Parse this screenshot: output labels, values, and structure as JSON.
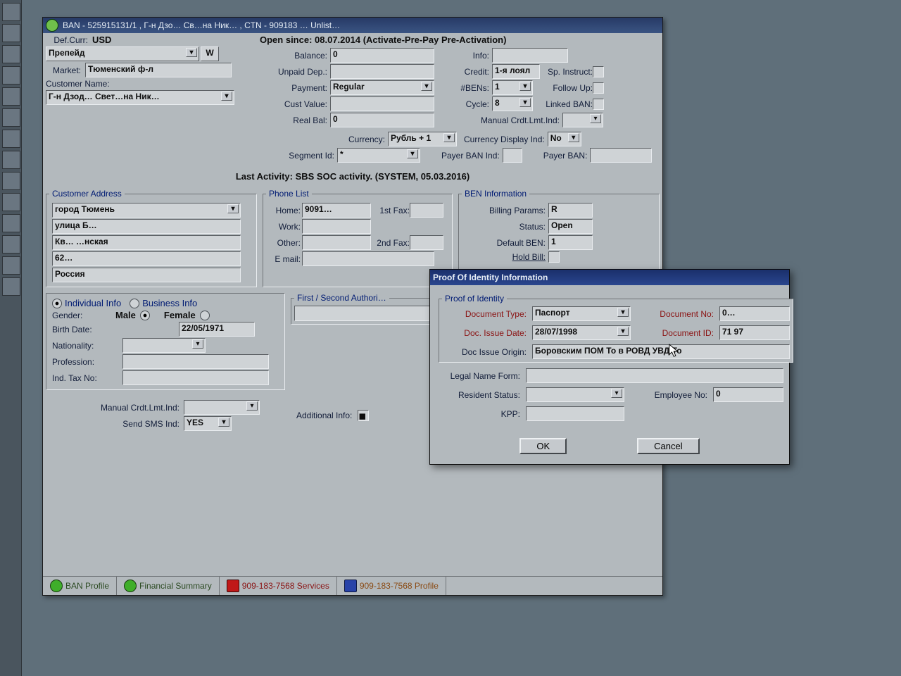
{
  "window": {
    "title": "BAN - 525915131/1 , Г-н Дзо… Св…на Ник… , CTN - 909183 …  Unlist…",
    "def_curr_label": "Def.Curr:",
    "def_curr": "USD",
    "open_since": "Open since: 08.07.2014 (Activate-Pre-Pay Pre-Activation)",
    "plan": "Препейд",
    "W": "W",
    "market_label": "Market:",
    "market": "Тюменский ф-л",
    "custname_label": "Customer Name:",
    "custname": "Г-н Дзод…  Свет…на Ник…"
  },
  "mid": {
    "balance_l": "Balance:",
    "balance": "0",
    "unpaid_l": "Unpaid Dep.:",
    "payment_l": "Payment:",
    "payment": "Regular",
    "custval_l": "Cust Value:",
    "realbal_l": "Real Bal:",
    "realbal": "0",
    "info_l": "Info:",
    "credit_l": "Credit:",
    "credit": "1-я лоял",
    "spinstr_l": "Sp. Instruct:",
    "bens_l": "#BENs:",
    "bens": "1",
    "followup_l": "Follow Up:",
    "cycle_l": "Cycle:",
    "cycle": "8",
    "linkedban_l": "Linked BAN:",
    "manualcrdt_l": "Manual Crdt.Lmt.Ind:",
    "currency_l": "Currency:",
    "currency": "Рубль + 1",
    "currdisp_l": "Currency Display Ind:",
    "currdisp": "No",
    "segment_l": "Segment Id:",
    "segment": "*",
    "payerbanind_l": "Payer BAN Ind:",
    "payerban_l": "Payer BAN:"
  },
  "activity": "Last Activity: SBS SOC activity. (SYSTEM, 05.03.2016)",
  "addr": {
    "title": "Customer Address",
    "line1": "город Тюмень",
    "line2": "улица Б…",
    "line3": "  Кв…                        …нская",
    "line4": "62…",
    "line5": "Россия"
  },
  "phone": {
    "title": "Phone List",
    "home_l": "Home:",
    "home": "9091…",
    "work_l": "Work:",
    "other_l": "Other:",
    "email_l": "E mail:",
    "fax1_l": "1st Fax:",
    "fax2_l": "2nd Fax:"
  },
  "ben": {
    "title": "BEN Information",
    "billing_l": "Billing Params:",
    "billing": "R",
    "status_l": "Status:",
    "status": "Open",
    "defben_l": "Default BEN:",
    "defben": "1",
    "hold_l": "Hold Bill:",
    "auth_l": "First / Second  Authori…"
  },
  "indiv": {
    "opt_ind": "Individual Info",
    "opt_bus": "Business Info",
    "gender_l": "Gender:",
    "male": "Male",
    "female": "Female",
    "birth_l": "Birth Date:",
    "birth": "22/05/1971",
    "nat_l": "Nationality:",
    "prof_l": "Profession:",
    "tax_l": "Ind. Tax No:"
  },
  "bottom": {
    "manualcrdt_l": "Manual Crdt.Lmt.Ind:",
    "sms_l": "Send SMS Ind:",
    "sms": "YES",
    "addinfo_l": "Additional Info:"
  },
  "tabs": {
    "t1": "BAN Profile",
    "t2": "Financial Summary",
    "t3": "909-183-7568 Services",
    "t4": "909-183-7568 Profile"
  },
  "dlg": {
    "title": "Proof Of Identity Information",
    "group": "Proof of Identity",
    "doctype_l": "Document Type:",
    "doctype": "Паспорт",
    "docno_l": "Document No:",
    "docno": "0…",
    "issuedate_l": "Doc. Issue Date:",
    "issuedate": "28/07/1998",
    "docid_l": "Document ID:",
    "docid": "71 97",
    "origin_l": "Doc Issue Origin:",
    "origin": "Боровским ПОМ То в РОВД УВД То",
    "legal_l": "Legal Name Form:",
    "resident_l": "Resident Status:",
    "emp_l": "Employee No:",
    "emp": "0",
    "kpp_l": "KPP:",
    "ok": "OK",
    "cancel": "Cancel"
  }
}
